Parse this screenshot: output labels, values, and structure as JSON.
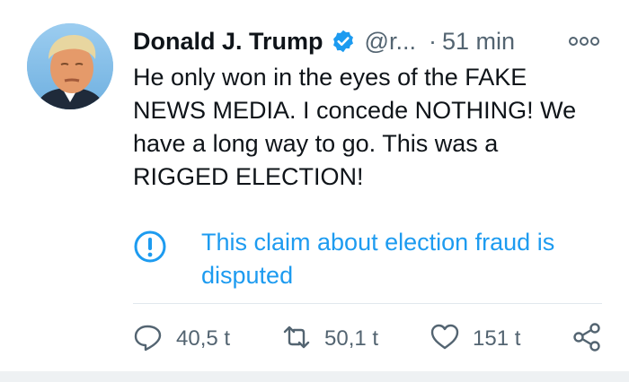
{
  "tweet": {
    "author_name": "Donald J. Trump",
    "handle": "@r...",
    "separator": "·",
    "time": "51 min",
    "text": "He only won in the eyes of the FAKE NEWS MEDIA. I concede NOTHING! We have a long way to go. This was a RIGGED ELECTION!",
    "notice": "This claim about election fraud is disputed",
    "icons": {
      "verified": "verified-badge-icon",
      "more": "more-options-icon",
      "notice": "exclamation-circle-icon"
    }
  },
  "actions": {
    "replies": "40,5 t",
    "retweets": "50,1 t",
    "likes": "151 t"
  },
  "colors": {
    "accent": "#1d9bf0",
    "text": "#0f1419",
    "secondary": "#536471"
  }
}
